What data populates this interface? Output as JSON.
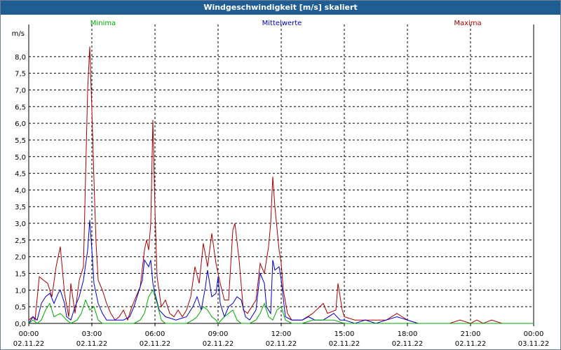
{
  "window": {
    "title": "Windgeschwindigkeit [m/s] skaliert"
  },
  "chart_data": {
    "type": "line",
    "title": "Windgeschwindigkeit [m/s] skaliert",
    "ylabel": "m/s",
    "xlabel": "",
    "ylim": [
      0,
      8.5
    ],
    "xlim_hours": [
      0,
      24
    ],
    "y_ticks": [
      "0,0",
      "0,5",
      "1,0",
      "1,5",
      "2,0",
      "2,5",
      "3,0",
      "3,5",
      "4,0",
      "4,5",
      "5,0",
      "5,5",
      "6,0",
      "6,5",
      "7,0",
      "7,5",
      "8,0"
    ],
    "x_ticks": [
      {
        "time": "00:00",
        "date": "02.11.22"
      },
      {
        "time": "03:00",
        "date": "02.11.22"
      },
      {
        "time": "06:00",
        "date": "02.11.22"
      },
      {
        "time": "09:00",
        "date": "02.11.22"
      },
      {
        "time": "12:00",
        "date": "02.11.22"
      },
      {
        "time": "15:00",
        "date": "02.11.22"
      },
      {
        "time": "18:00",
        "date": "02.11.22"
      },
      {
        "time": "21:00",
        "date": "02.11.22"
      },
      {
        "time": "00:00",
        "date": "03.11.22"
      }
    ],
    "grid": true,
    "legend_position": "top",
    "series": [
      {
        "name": "Minima",
        "color": "#00aa00",
        "points": [
          [
            0,
            0
          ],
          [
            0.2,
            0.1
          ],
          [
            0.4,
            0
          ],
          [
            0.6,
            0.1
          ],
          [
            0.8,
            0.4
          ],
          [
            1.0,
            0.6
          ],
          [
            1.2,
            0.2
          ],
          [
            1.5,
            0.3
          ],
          [
            1.8,
            0.1
          ],
          [
            2.0,
            0
          ],
          [
            2.3,
            0.1
          ],
          [
            2.5,
            0.3
          ],
          [
            2.7,
            0.7
          ],
          [
            2.9,
            0.4
          ],
          [
            3.1,
            0.5
          ],
          [
            3.3,
            0.1
          ],
          [
            3.5,
            0
          ],
          [
            4,
            0
          ],
          [
            4.5,
            0
          ],
          [
            5,
            0
          ],
          [
            5.3,
            0.1
          ],
          [
            5.5,
            0.3
          ],
          [
            5.7,
            0.8
          ],
          [
            5.9,
            1.0
          ],
          [
            6.1,
            0.6
          ],
          [
            6.3,
            0.1
          ],
          [
            6.5,
            0
          ],
          [
            7,
            0
          ],
          [
            7.5,
            0
          ],
          [
            7.8,
            0.1
          ],
          [
            8,
            0.2
          ],
          [
            8.3,
            0.5
          ],
          [
            8.5,
            0.4
          ],
          [
            8.7,
            0.2
          ],
          [
            8.9,
            0.1
          ],
          [
            9,
            0
          ],
          [
            9.3,
            0.2
          ],
          [
            9.5,
            0.3
          ],
          [
            9.7,
            0.4
          ],
          [
            9.9,
            0.1
          ],
          [
            10.1,
            0
          ],
          [
            10.5,
            0
          ],
          [
            10.8,
            0.1
          ],
          [
            11,
            0.3
          ],
          [
            11.2,
            0.6
          ],
          [
            11.4,
            0.2
          ],
          [
            11.6,
            0.1
          ],
          [
            11.8,
            0.4
          ],
          [
            12,
            0.5
          ],
          [
            12.2,
            0.1
          ],
          [
            12.5,
            0
          ],
          [
            13,
            0
          ],
          [
            13.5,
            0.1
          ],
          [
            14,
            0.1
          ],
          [
            14.5,
            0.1
          ],
          [
            15,
            0
          ],
          [
            24,
            0
          ]
        ]
      },
      {
        "name": "Mittelwerte",
        "color": "#0000cc",
        "points": [
          [
            0,
            0
          ],
          [
            0.2,
            0.2
          ],
          [
            0.4,
            0.1
          ],
          [
            0.6,
            0.6
          ],
          [
            0.8,
            0.8
          ],
          [
            1.0,
            0.9
          ],
          [
            1.2,
            0.6
          ],
          [
            1.4,
            0.9
          ],
          [
            1.5,
            1.0
          ],
          [
            1.7,
            0.6
          ],
          [
            1.8,
            0.2
          ],
          [
            2.0,
            0.1
          ],
          [
            2.2,
            0.5
          ],
          [
            2.4,
            0.8
          ],
          [
            2.6,
            1.3
          ],
          [
            2.8,
            2.2
          ],
          [
            2.9,
            3.1
          ],
          [
            3.0,
            2.2
          ],
          [
            3.1,
            1.2
          ],
          [
            3.3,
            0.6
          ],
          [
            3.5,
            0.3
          ],
          [
            3.7,
            0.1
          ],
          [
            4,
            0.1
          ],
          [
            4.5,
            0.1
          ],
          [
            4.8,
            0.2
          ],
          [
            5.0,
            0.5
          ],
          [
            5.2,
            0.9
          ],
          [
            5.4,
            1.3
          ],
          [
            5.5,
            1.9
          ],
          [
            5.7,
            1.7
          ],
          [
            5.8,
            1.9
          ],
          [
            5.9,
            1.2
          ],
          [
            6.0,
            0.9
          ],
          [
            6.2,
            0.4
          ],
          [
            6.5,
            0.2
          ],
          [
            7,
            0.1
          ],
          [
            7.5,
            0.2
          ],
          [
            7.8,
            0.5
          ],
          [
            8,
            0.8
          ],
          [
            8.2,
            0.4
          ],
          [
            8.4,
            1.1
          ],
          [
            8.5,
            1.6
          ],
          [
            8.7,
            0.8
          ],
          [
            8.9,
            0.9
          ],
          [
            9,
            1.4
          ],
          [
            9.1,
            0.6
          ],
          [
            9.3,
            0.2
          ],
          [
            9.5,
            0.5
          ],
          [
            9.7,
            0.6
          ],
          [
            9.9,
            0.8
          ],
          [
            10.1,
            0.7
          ],
          [
            10.3,
            0.2
          ],
          [
            10.5,
            0.1
          ],
          [
            10.8,
            0.4
          ],
          [
            11.0,
            1.5
          ],
          [
            11.2,
            1.2
          ],
          [
            11.3,
            0.5
          ],
          [
            11.5,
            0.3
          ],
          [
            11.6,
            1.9
          ],
          [
            11.7,
            1.6
          ],
          [
            11.9,
            1.7
          ],
          [
            12,
            1.3
          ],
          [
            12.2,
            0.2
          ],
          [
            12.5,
            0.1
          ],
          [
            13,
            0.1
          ],
          [
            13.3,
            0.2
          ],
          [
            13.6,
            0.1
          ],
          [
            14,
            0.1
          ],
          [
            14.5,
            0.3
          ],
          [
            14.8,
            0.1
          ],
          [
            15,
            0.1
          ],
          [
            15.5,
            0
          ],
          [
            16,
            0.1
          ],
          [
            16.5,
            0
          ],
          [
            17,
            0.1
          ],
          [
            17.5,
            0.2
          ],
          [
            18,
            0.1
          ],
          [
            18.5,
            0
          ],
          [
            19,
            0
          ],
          [
            24,
            0
          ]
        ]
      },
      {
        "name": "Maxima",
        "color": "#aa0000",
        "points": [
          [
            0,
            0.1
          ],
          [
            0.2,
            0.2
          ],
          [
            0.3,
            0.1
          ],
          [
            0.5,
            1.4
          ],
          [
            0.7,
            1.3
          ],
          [
            0.9,
            1.2
          ],
          [
            1.1,
            0.8
          ],
          [
            1.3,
            1.7
          ],
          [
            1.5,
            2.3
          ],
          [
            1.7,
            0.9
          ],
          [
            1.9,
            0.2
          ],
          [
            2.0,
            1.2
          ],
          [
            2.2,
            0.3
          ],
          [
            2.4,
            1.3
          ],
          [
            2.6,
            1.7
          ],
          [
            2.7,
            4.4
          ],
          [
            2.8,
            7.0
          ],
          [
            2.9,
            8.3
          ],
          [
            3.0,
            6.4
          ],
          [
            3.1,
            4.3
          ],
          [
            3.2,
            2.4
          ],
          [
            3.3,
            1.3
          ],
          [
            3.5,
            1.0
          ],
          [
            3.7,
            0.6
          ],
          [
            3.9,
            0.3
          ],
          [
            4.1,
            0.1
          ],
          [
            4.3,
            0.2
          ],
          [
            4.5,
            0.4
          ],
          [
            4.7,
            0.1
          ],
          [
            4.9,
            0.5
          ],
          [
            5.1,
            0.8
          ],
          [
            5.3,
            1.1
          ],
          [
            5.5,
            2.2
          ],
          [
            5.6,
            2.5
          ],
          [
            5.7,
            2.2
          ],
          [
            5.8,
            3.0
          ],
          [
            5.9,
            6.1
          ],
          [
            6.0,
            3.4
          ],
          [
            6.1,
            1.4
          ],
          [
            6.3,
            0.5
          ],
          [
            6.5,
            0.7
          ],
          [
            6.7,
            0.3
          ],
          [
            6.9,
            0.2
          ],
          [
            7.1,
            0.4
          ],
          [
            7.3,
            0.2
          ],
          [
            7.5,
            0.4
          ],
          [
            7.7,
            0.8
          ],
          [
            7.9,
            1.7
          ],
          [
            8.1,
            1.2
          ],
          [
            8.3,
            2.4
          ],
          [
            8.5,
            1.7
          ],
          [
            8.7,
            2.7
          ],
          [
            8.9,
            1.8
          ],
          [
            9.1,
            1.2
          ],
          [
            9.3,
            0.7
          ],
          [
            9.5,
            0.7
          ],
          [
            9.7,
            2.8
          ],
          [
            9.8,
            3.0
          ],
          [
            10.0,
            1.9
          ],
          [
            10.2,
            0.4
          ],
          [
            10.4,
            0.3
          ],
          [
            10.6,
            0.5
          ],
          [
            10.8,
            0.7
          ],
          [
            11.0,
            1.8
          ],
          [
            11.2,
            1.5
          ],
          [
            11.4,
            2.3
          ],
          [
            11.5,
            3.0
          ],
          [
            11.6,
            4.4
          ],
          [
            11.7,
            3.5
          ],
          [
            11.9,
            2.2
          ],
          [
            12.0,
            1.8
          ],
          [
            12.1,
            1.0
          ],
          [
            12.3,
            0.3
          ],
          [
            12.5,
            0.1
          ],
          [
            13,
            0.1
          ],
          [
            13.5,
            0.3
          ],
          [
            14,
            0.6
          ],
          [
            14.2,
            0.3
          ],
          [
            14.6,
            0.4
          ],
          [
            14.7,
            1.2
          ],
          [
            14.9,
            0.4
          ],
          [
            15,
            0.2
          ],
          [
            15.5,
            0.1
          ],
          [
            16,
            0.1
          ],
          [
            16.5,
            0.1
          ],
          [
            17,
            0.1
          ],
          [
            17.5,
            0.3
          ],
          [
            18,
            0.1
          ],
          [
            18.5,
            0
          ],
          [
            19,
            0
          ],
          [
            20,
            0
          ],
          [
            20.5,
            0.1
          ],
          [
            21,
            0
          ],
          [
            21.3,
            0.1
          ],
          [
            21.6,
            0
          ],
          [
            22,
            0.1
          ],
          [
            22.5,
            0
          ],
          [
            24,
            0
          ]
        ]
      }
    ]
  }
}
